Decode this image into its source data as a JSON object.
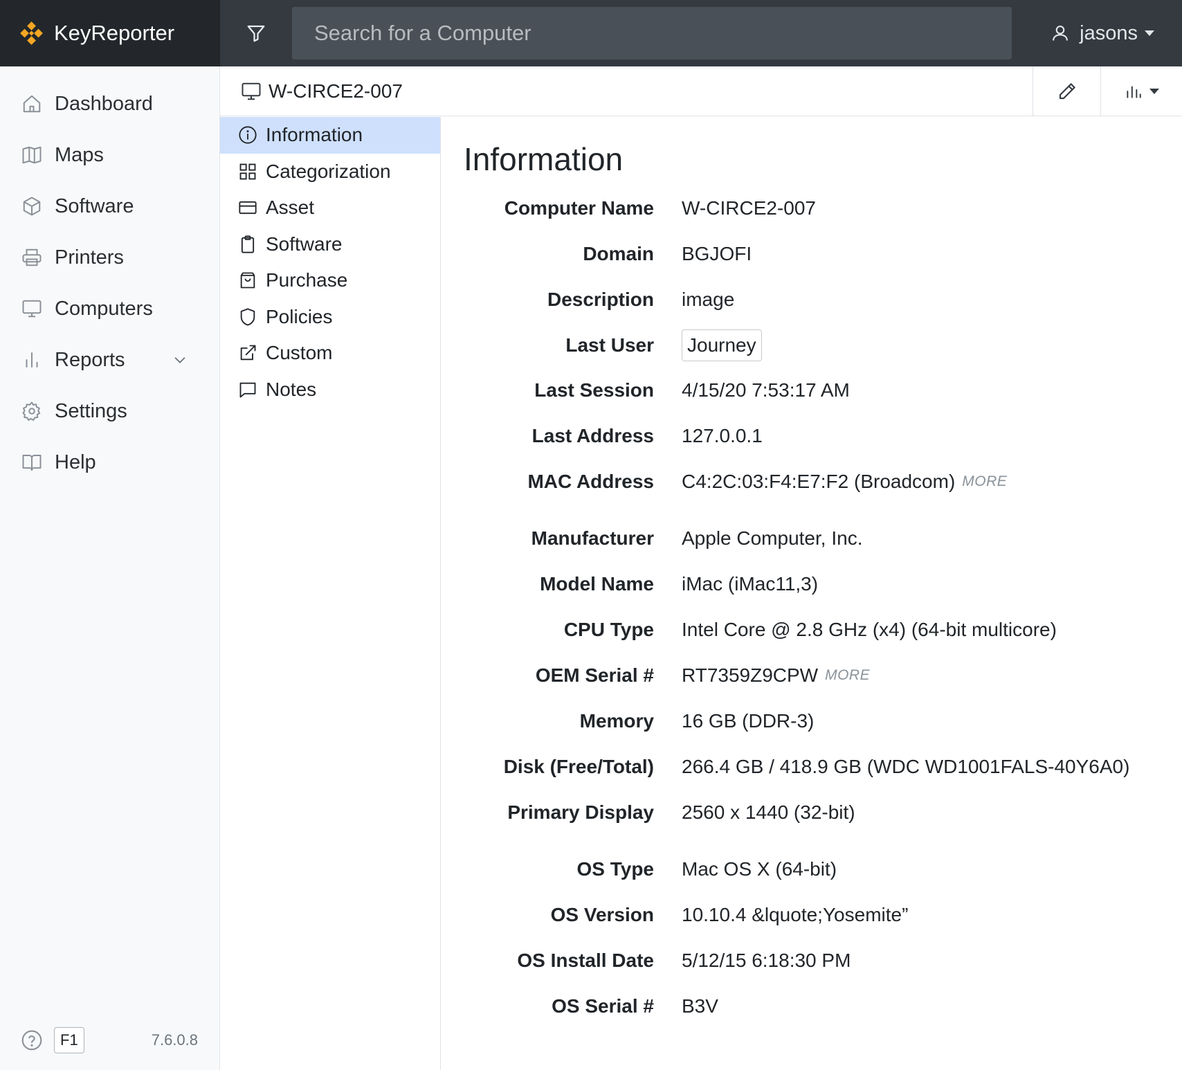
{
  "app": {
    "name": "KeyReporter",
    "brand_color": "#f5a623",
    "search_placeholder": "Search for a Computer",
    "user": "jasons"
  },
  "sidebar": {
    "items": [
      {
        "label": "Dashboard",
        "icon": "home-icon"
      },
      {
        "label": "Maps",
        "icon": "map-icon"
      },
      {
        "label": "Software",
        "icon": "box-icon"
      },
      {
        "label": "Printers",
        "icon": "printer-icon"
      },
      {
        "label": "Computers",
        "icon": "monitor-icon"
      },
      {
        "label": "Reports",
        "icon": "bar-chart-icon"
      },
      {
        "label": "Settings",
        "icon": "gear-icon"
      },
      {
        "label": "Help",
        "icon": "book-icon"
      }
    ],
    "footer": {
      "f1": "F1",
      "version": "7.6.0.8"
    }
  },
  "computer": {
    "name": "W-CIRCE2-007"
  },
  "subnav": {
    "items": [
      {
        "label": "Information",
        "icon": "info-icon",
        "active": true
      },
      {
        "label": "Categorization",
        "icon": "grid-icon"
      },
      {
        "label": "Asset",
        "icon": "card-icon"
      },
      {
        "label": "Software",
        "icon": "clipboard-icon"
      },
      {
        "label": "Purchase",
        "icon": "bag-icon"
      },
      {
        "label": "Policies",
        "icon": "shield-icon"
      },
      {
        "label": "Custom",
        "icon": "external-link-icon"
      },
      {
        "label": "Notes",
        "icon": "message-icon"
      }
    ]
  },
  "info": {
    "title": "Information",
    "more_label": "MORE",
    "rows": [
      {
        "label": "Computer Name",
        "value": "W-CIRCE2-007"
      },
      {
        "label": "Domain",
        "value": "BGJOFI"
      },
      {
        "label": "Description",
        "value": "image"
      },
      {
        "label": "Last User",
        "value": "Journey"
      },
      {
        "label": "Last Session",
        "value": "4/15/20 7:53:17 AM"
      },
      {
        "label": "Last Address",
        "value": "127.0.0.1"
      },
      {
        "label": "MAC Address",
        "value": "C4:2C:03:F4:E7:F2 (Broadcom)"
      },
      {
        "label": "Manufacturer",
        "value": "Apple Computer, Inc."
      },
      {
        "label": "Model Name",
        "value": "iMac (iMac11,3)"
      },
      {
        "label": "CPU Type",
        "value": "Intel Core @ 2.8 GHz (x4) (64-bit multicore)"
      },
      {
        "label": "OEM Serial #",
        "value": "RT7359Z9CPW"
      },
      {
        "label": "Memory",
        "value": "16 GB (DDR-3)"
      },
      {
        "label": "Disk (Free/Total)",
        "value": "266.4 GB / 418.9 GB (WDC WD1001FALS-40Y6A0)"
      },
      {
        "label": "Primary Display",
        "value": "2560 x 1440 (32-bit)"
      },
      {
        "label": "OS Type",
        "value": "Mac OS X (64-bit)"
      },
      {
        "label": "OS Version",
        "value": "10.10.4 &lquote;Yosemite”"
      },
      {
        "label": "OS Install Date",
        "value": "5/12/15 6:18:30 PM"
      },
      {
        "label": "OS Serial #",
        "value": "B3V"
      }
    ]
  }
}
